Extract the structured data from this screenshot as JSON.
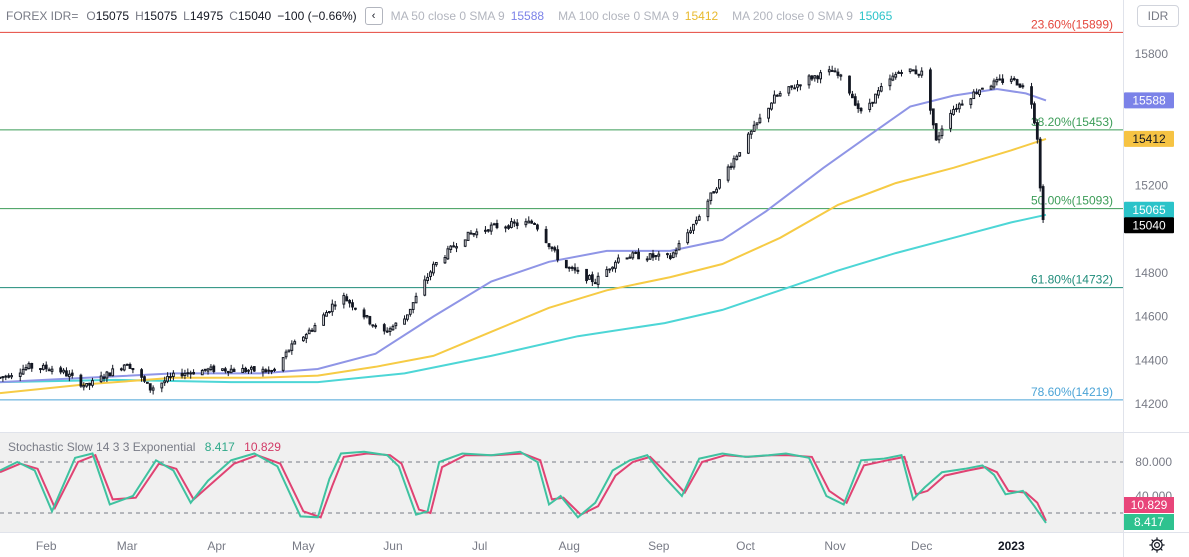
{
  "header": {
    "symbol": "FOREX IDR=",
    "open_label": "O",
    "open": "15075",
    "high_label": "H",
    "high": "15075",
    "low_label": "L",
    "low": "14975",
    "close_label": "C",
    "close": "15040",
    "change": "−100 (−0.66%)",
    "ma50_label": "MA 50 close 0 SMA 9",
    "ma50_value": "15588",
    "ma100_label": "MA 100 close 0 SMA 9",
    "ma100_value": "15412",
    "ma200_label": "MA 200 close 0 SMA 9",
    "ma200_value": "15065",
    "currency_button": "IDR"
  },
  "colors": {
    "up": "#131722",
    "down": "#131722",
    "ma50": "#8f95e6",
    "ma100": "#f6cb45",
    "ma200": "#4dd6d6",
    "fib_red": "#e4463c",
    "fib_green": "#3b9c57",
    "fib_teal": "#1f8c7a",
    "fib_blue": "#4aa3d6",
    "stoch_k": "#3fc2a0",
    "stoch_d": "#e04373"
  },
  "chart_data": {
    "type": "candlestick",
    "title": "FOREX IDR=",
    "ylim": [
      14000,
      15900
    ],
    "y_ticks": [
      "14200",
      "14400",
      "14600",
      "14800",
      "15000",
      "15200",
      "15400",
      "15600",
      "15800"
    ],
    "x_labels": [
      "Feb",
      "Mar",
      "Apr",
      "May",
      "Jun",
      "Jul",
      "Aug",
      "Sep",
      "Oct",
      "Nov",
      "Dec",
      "2023"
    ],
    "x_label_days": [
      16,
      44,
      75,
      105,
      136,
      166,
      197,
      228,
      258,
      289,
      319,
      350
    ],
    "days_range": [
      0,
      370
    ],
    "price_path": [
      [
        0,
        14320
      ],
      [
        10,
        14370
      ],
      [
        20,
        14360
      ],
      [
        30,
        14280
      ],
      [
        44,
        14390
      ],
      [
        52,
        14270
      ],
      [
        62,
        14340
      ],
      [
        75,
        14360
      ],
      [
        95,
        14350
      ],
      [
        100,
        14450
      ],
      [
        110,
        14570
      ],
      [
        118,
        14700
      ],
      [
        125,
        14620
      ],
      [
        132,
        14520
      ],
      [
        140,
        14590
      ],
      [
        150,
        14830
      ],
      [
        160,
        14960
      ],
      [
        170,
        15010
      ],
      [
        185,
        15030
      ],
      [
        195,
        14830
      ],
      [
        206,
        14760
      ],
      [
        215,
        14880
      ],
      [
        232,
        14870
      ],
      [
        240,
        15020
      ],
      [
        250,
        15240
      ],
      [
        258,
        15400
      ],
      [
        268,
        15600
      ],
      [
        280,
        15690
      ],
      [
        288,
        15720
      ],
      [
        292,
        15680
      ],
      [
        298,
        15530
      ],
      [
        305,
        15640
      ],
      [
        312,
        15730
      ],
      [
        320,
        15710
      ],
      [
        324,
        15400
      ],
      [
        328,
        15530
      ],
      [
        340,
        15650
      ],
      [
        350,
        15690
      ],
      [
        355,
        15640
      ],
      [
        357,
        15580
      ],
      [
        359,
        15420
      ],
      [
        360,
        15200
      ],
      [
        361,
        15040
      ]
    ],
    "ma50_path": [
      [
        0,
        14300
      ],
      [
        30,
        14320
      ],
      [
        60,
        14340
      ],
      [
        90,
        14340
      ],
      [
        110,
        14360
      ],
      [
        130,
        14430
      ],
      [
        150,
        14600
      ],
      [
        170,
        14760
      ],
      [
        190,
        14850
      ],
      [
        210,
        14900
      ],
      [
        232,
        14900
      ],
      [
        250,
        14950
      ],
      [
        265,
        15080
      ],
      [
        285,
        15280
      ],
      [
        300,
        15420
      ],
      [
        315,
        15560
      ],
      [
        330,
        15610
      ],
      [
        345,
        15640
      ],
      [
        355,
        15620
      ],
      [
        362,
        15588
      ]
    ],
    "ma100_path": [
      [
        0,
        14250
      ],
      [
        30,
        14290
      ],
      [
        60,
        14320
      ],
      [
        90,
        14320
      ],
      [
        110,
        14330
      ],
      [
        130,
        14370
      ],
      [
        150,
        14420
      ],
      [
        170,
        14530
      ],
      [
        190,
        14640
      ],
      [
        210,
        14720
      ],
      [
        232,
        14780
      ],
      [
        250,
        14840
      ],
      [
        270,
        14960
      ],
      [
        290,
        15110
      ],
      [
        310,
        15210
      ],
      [
        330,
        15280
      ],
      [
        350,
        15360
      ],
      [
        362,
        15412
      ]
    ],
    "ma200_path": [
      [
        0,
        14300
      ],
      [
        40,
        14310
      ],
      [
        80,
        14300
      ],
      [
        110,
        14300
      ],
      [
        140,
        14340
      ],
      [
        170,
        14420
      ],
      [
        200,
        14510
      ],
      [
        230,
        14570
      ],
      [
        250,
        14630
      ],
      [
        270,
        14720
      ],
      [
        290,
        14810
      ],
      [
        310,
        14890
      ],
      [
        330,
        14960
      ],
      [
        350,
        15030
      ],
      [
        362,
        15065
      ]
    ],
    "fib_levels": [
      {
        "label": "23.60%(15899)",
        "value": 15899,
        "color": "#e4463c"
      },
      {
        "label": "38.20%(15453)",
        "value": 15453,
        "color": "#3b9c57"
      },
      {
        "label": "50.00%(15093)",
        "value": 15093,
        "color": "#3b9c57"
      },
      {
        "label": "61.80%(14732)",
        "value": 14732,
        "color": "#1f8c7a"
      },
      {
        "label": "78.60%(14219)",
        "value": 14219,
        "color": "#4aa3d6"
      }
    ],
    "price_badges": [
      {
        "value": 15588,
        "text": "15588",
        "bg": "#7b82e8",
        "fg": "#ffffff"
      },
      {
        "value": 15412,
        "text": "15412",
        "bg": "#f6c343",
        "fg": "#131722"
      },
      {
        "value": 15065,
        "text": "15065",
        "bg": "#2bc3c9",
        "fg": "#ffffff"
      },
      {
        "value": 15040,
        "text": "15040",
        "bg": "#000000",
        "fg": "#ffffff"
      }
    ],
    "stochastic": {
      "label": "Stochastic Slow 14 3 3 Exponential",
      "k_value": "8.417",
      "d_value": "10.829",
      "ylim": [
        0,
        100
      ],
      "y_ticks": [
        "80.000",
        "40.000"
      ],
      "upper_band": 80,
      "lower_band": 20,
      "k_path": [
        [
          0,
          70
        ],
        [
          6,
          80
        ],
        [
          12,
          70
        ],
        [
          18,
          22
        ],
        [
          26,
          85
        ],
        [
          32,
          90
        ],
        [
          38,
          30
        ],
        [
          46,
          40
        ],
        [
          54,
          82
        ],
        [
          60,
          70
        ],
        [
          66,
          32
        ],
        [
          72,
          58
        ],
        [
          80,
          82
        ],
        [
          88,
          90
        ],
        [
          96,
          75
        ],
        [
          104,
          16
        ],
        [
          110,
          15
        ],
        [
          114,
          60
        ],
        [
          118,
          90
        ],
        [
          126,
          92
        ],
        [
          134,
          88
        ],
        [
          138,
          75
        ],
        [
          144,
          18
        ],
        [
          148,
          22
        ],
        [
          152,
          80
        ],
        [
          160,
          90
        ],
        [
          170,
          88
        ],
        [
          180,
          92
        ],
        [
          186,
          80
        ],
        [
          190,
          30
        ],
        [
          194,
          40
        ],
        [
          200,
          15
        ],
        [
          206,
          32
        ],
        [
          212,
          70
        ],
        [
          218,
          82
        ],
        [
          224,
          88
        ],
        [
          230,
          62
        ],
        [
          236,
          40
        ],
        [
          242,
          84
        ],
        [
          250,
          90
        ],
        [
          258,
          86
        ],
        [
          266,
          88
        ],
        [
          272,
          90
        ],
        [
          280,
          85
        ],
        [
          286,
          40
        ],
        [
          292,
          30
        ],
        [
          298,
          82
        ],
        [
          306,
          84
        ],
        [
          312,
          88
        ],
        [
          316,
          36
        ],
        [
          320,
          50
        ],
        [
          326,
          68
        ],
        [
          334,
          72
        ],
        [
          340,
          76
        ],
        [
          344,
          65
        ],
        [
          348,
          42
        ],
        [
          354,
          46
        ],
        [
          358,
          28
        ],
        [
          362,
          8.4
        ]
      ],
      "d_path": [
        [
          0,
          68
        ],
        [
          7,
          78
        ],
        [
          13,
          72
        ],
        [
          19,
          26
        ],
        [
          27,
          80
        ],
        [
          33,
          88
        ],
        [
          39,
          36
        ],
        [
          47,
          38
        ],
        [
          55,
          78
        ],
        [
          61,
          72
        ],
        [
          67,
          36
        ],
        [
          73,
          54
        ],
        [
          81,
          78
        ],
        [
          89,
          88
        ],
        [
          97,
          78
        ],
        [
          105,
          22
        ],
        [
          111,
          15
        ],
        [
          115,
          52
        ],
        [
          119,
          86
        ],
        [
          127,
          90
        ],
        [
          135,
          88
        ],
        [
          139,
          78
        ],
        [
          145,
          24
        ],
        [
          149,
          20
        ],
        [
          153,
          74
        ],
        [
          161,
          88
        ],
        [
          171,
          88
        ],
        [
          181,
          90
        ],
        [
          187,
          82
        ],
        [
          191,
          36
        ],
        [
          195,
          38
        ],
        [
          201,
          18
        ],
        [
          207,
          28
        ],
        [
          213,
          64
        ],
        [
          219,
          80
        ],
        [
          225,
          86
        ],
        [
          231,
          66
        ],
        [
          237,
          44
        ],
        [
          243,
          80
        ],
        [
          251,
          88
        ],
        [
          259,
          86
        ],
        [
          267,
          88
        ],
        [
          273,
          88
        ],
        [
          281,
          86
        ],
        [
          287,
          46
        ],
        [
          293,
          32
        ],
        [
          299,
          76
        ],
        [
          307,
          82
        ],
        [
          313,
          86
        ],
        [
          317,
          42
        ],
        [
          321,
          46
        ],
        [
          327,
          64
        ],
        [
          335,
          70
        ],
        [
          341,
          74
        ],
        [
          345,
          68
        ],
        [
          349,
          46
        ],
        [
          355,
          44
        ],
        [
          359,
          32
        ],
        [
          362,
          10.8
        ]
      ]
    }
  }
}
